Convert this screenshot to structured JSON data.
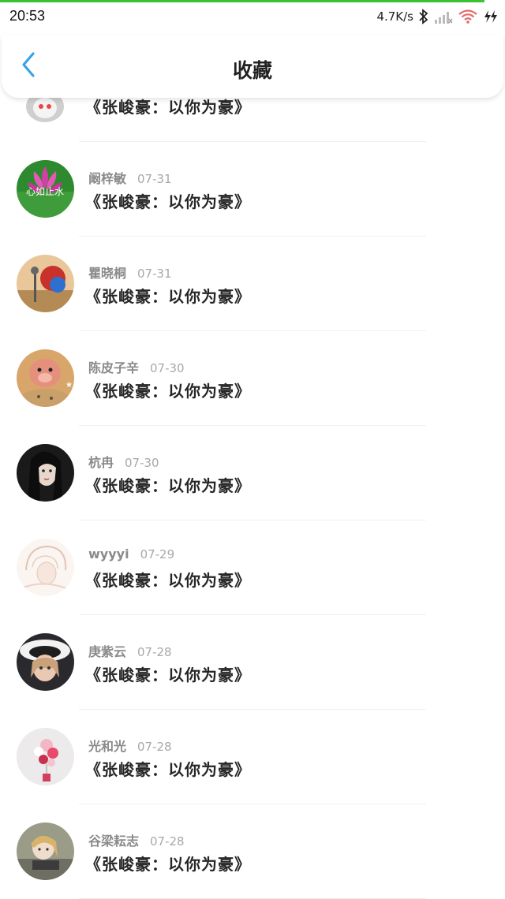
{
  "status_bar": {
    "time": "20:53",
    "net_speed": "4.7K/s",
    "icons": [
      "bluetooth-icon",
      "signal-icon",
      "wifi-icon",
      "charging-icon"
    ]
  },
  "header": {
    "title": "收藏",
    "back_icon": "chevron-left-icon"
  },
  "colors": {
    "accent": "#3aa3e6",
    "progress": "#3bc234",
    "title_text": "#262626",
    "meta_text": "#8e8e8e"
  },
  "items": [
    {
      "name": "",
      "date": "",
      "title": "《张峻豪：以你为豪》",
      "avatar": "penguin-avatar"
    },
    {
      "name": "阚梓敏",
      "date": "07-31",
      "title": "《张峻豪：以你为豪》",
      "avatar": "lotus-avatar",
      "avatar_text": "心如止水"
    },
    {
      "name": "瞿晓桐",
      "date": "07-31",
      "title": "《张峻豪：以你为豪》",
      "avatar": "painting-avatar"
    },
    {
      "name": "陈皮子辛",
      "date": "07-30",
      "title": "《张峻豪：以你为豪》",
      "avatar": "plush-avatar"
    },
    {
      "name": "杭冉",
      "date": "07-30",
      "title": "《张峻豪：以你为豪》",
      "avatar": "girl-dark-avatar"
    },
    {
      "name": "wyyyi",
      "date": "07-29",
      "title": "《张峻豪：以你为豪》",
      "avatar": "sketch-avatar"
    },
    {
      "name": "庚紫云",
      "date": "07-28",
      "title": "《张峻豪：以你为豪》",
      "avatar": "hat-girl-avatar"
    },
    {
      "name": "光和光",
      "date": "07-28",
      "title": "《张峻豪：以你为豪》",
      "avatar": "balloons-avatar"
    },
    {
      "name": "谷梁耘志",
      "date": "07-28",
      "title": "《张峻豪：以你为豪》",
      "avatar": "anime-avatar"
    }
  ]
}
